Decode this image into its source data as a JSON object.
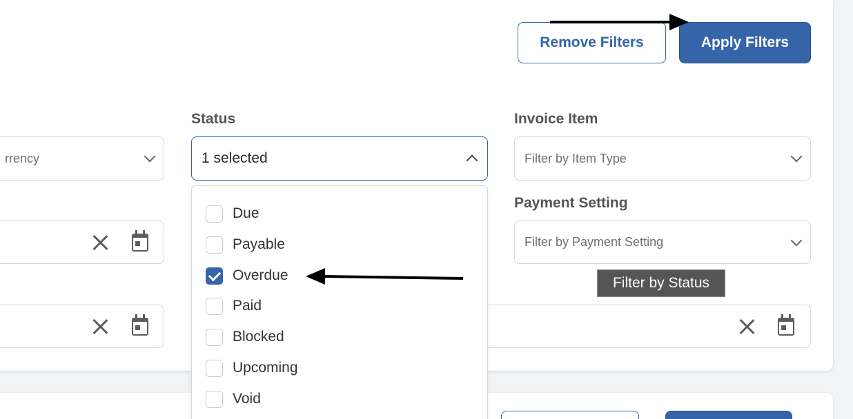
{
  "actions": {
    "remove_filters_label": "Remove Filters",
    "apply_filters_label": "Apply Filters"
  },
  "filters": {
    "currency": {
      "placeholder": "rrency"
    },
    "status": {
      "label": "Status",
      "value": "1 selected",
      "options": [
        {
          "label": "Due",
          "checked": false
        },
        {
          "label": "Payable",
          "checked": false
        },
        {
          "label": "Overdue",
          "checked": true
        },
        {
          "label": "Paid",
          "checked": false
        },
        {
          "label": "Blocked",
          "checked": false
        },
        {
          "label": "Upcoming",
          "checked": false
        },
        {
          "label": "Void",
          "checked": false
        }
      ]
    },
    "invoice_item": {
      "label": "Invoice Item",
      "placeholder": "Filter by Item Type"
    },
    "payment_setting": {
      "label": "Payment Setting",
      "placeholder": "Filter by Payment Setting"
    }
  },
  "tooltip": {
    "text": "Filter by Status"
  },
  "colors": {
    "primary": "#3565a8",
    "border": "#d4d6da",
    "tooltip_bg": "#555555"
  },
  "icons": [
    "chevron-down-icon",
    "chevron-up-icon",
    "clear-icon",
    "calendar-icon",
    "checkmark-icon",
    "annotation-arrow"
  ]
}
